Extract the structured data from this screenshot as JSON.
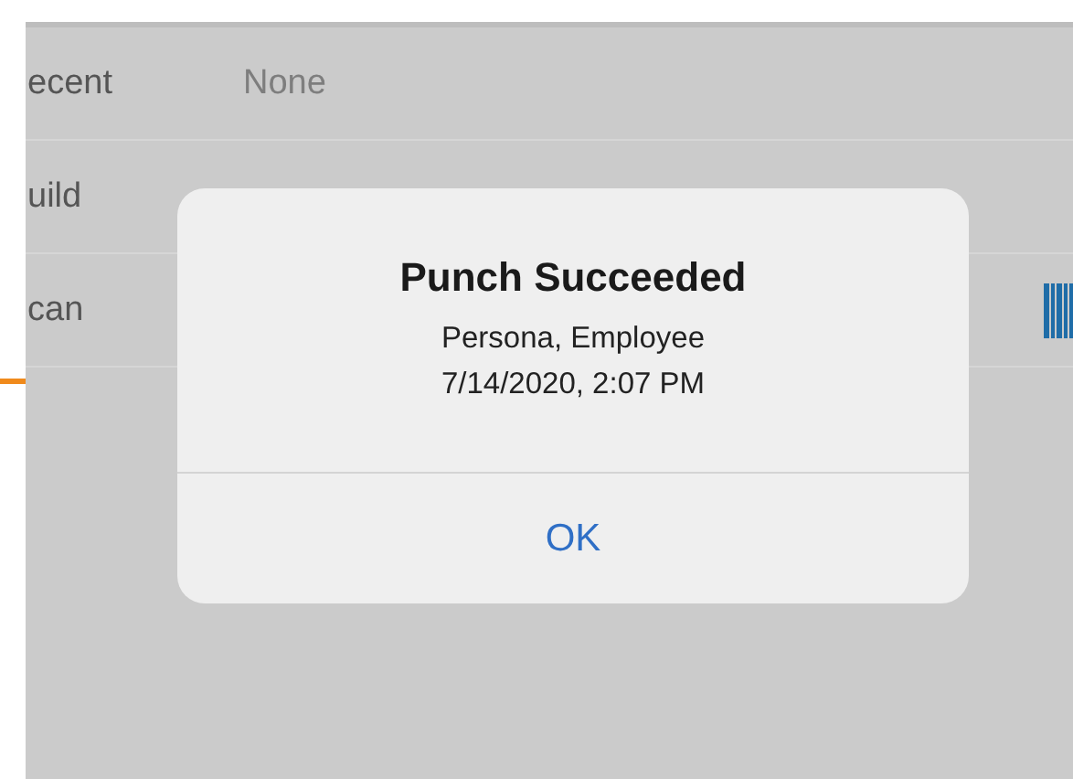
{
  "rows": [
    {
      "label": "ecent",
      "kind": "value",
      "value": "None"
    },
    {
      "label": "uild",
      "kind": "plain"
    },
    {
      "label": "can",
      "kind": "barcode"
    }
  ],
  "alert": {
    "title": "Punch Succeeded",
    "lines": [
      "Persona, Employee",
      "7/14/2020, 2:07 PM"
    ],
    "button": "OK"
  }
}
